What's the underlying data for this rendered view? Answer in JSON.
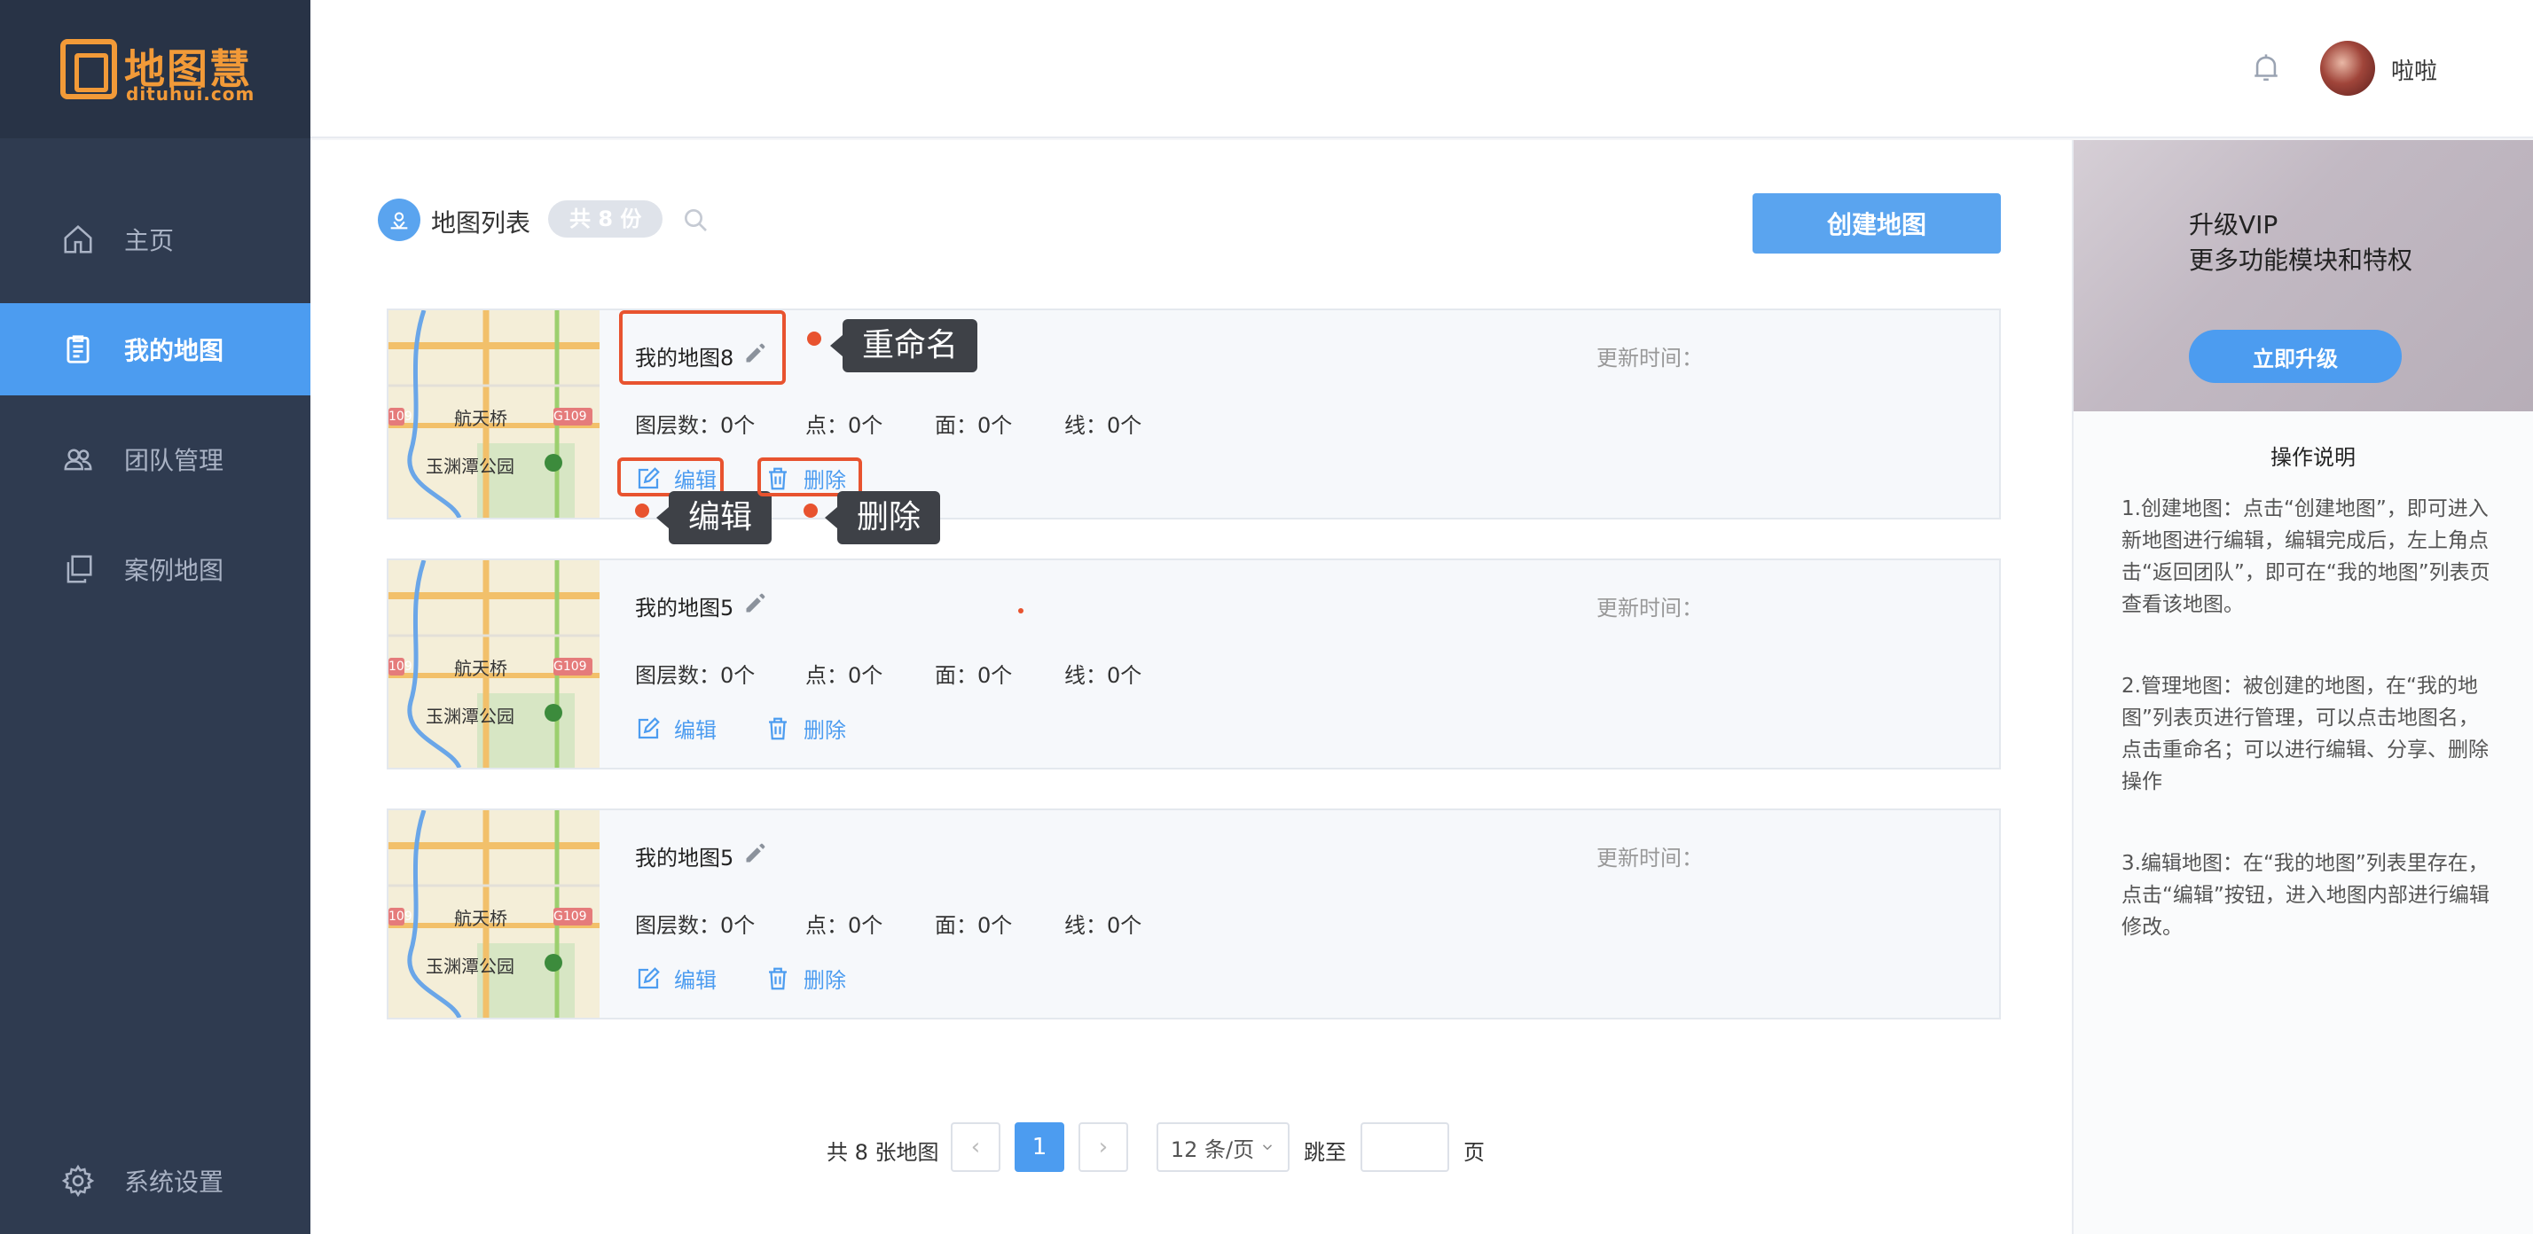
{
  "brand": {
    "name_cn": "地图慧",
    "name_en": "dituhui.com",
    "color": "#f29a38"
  },
  "sidebar": {
    "items": [
      {
        "label": "主页",
        "icon": "home-icon",
        "active": false
      },
      {
        "label": "我的地图",
        "icon": "clipboard-icon",
        "active": true
      },
      {
        "label": "团队管理",
        "icon": "team-icon",
        "active": false
      },
      {
        "label": "案例地图",
        "icon": "copy-icon",
        "active": false
      }
    ],
    "settings_label": "系统设置"
  },
  "header": {
    "username": "啦啦"
  },
  "list": {
    "title": "地图列表",
    "count_badge": "共 8 份",
    "create_button": "创建地图",
    "cards": [
      {
        "name": "我的地图8",
        "updated_label": "更新时间：",
        "stats": {
          "layers": "图层数：0个",
          "points": "点：0个",
          "areas": "面：0个",
          "lines": "线：0个"
        },
        "edit": "编辑",
        "delete": "删除"
      },
      {
        "name": "我的地图5",
        "updated_label": "更新时间：",
        "stats": {
          "layers": "图层数：0个",
          "points": "点：0个",
          "areas": "面：0个",
          "lines": "线：0个"
        },
        "edit": "编辑",
        "delete": "删除"
      },
      {
        "name": "我的地图5",
        "updated_label": "更新时间：",
        "stats": {
          "layers": "图层数：0个",
          "points": "点：0个",
          "areas": "面：0个",
          "lines": "线：0个"
        },
        "edit": "编辑",
        "delete": "删除"
      }
    ],
    "thumb_labels": {
      "bridge": "航天桥",
      "park": "玉渊潭公园",
      "road1": "G109",
      "road2": "109"
    }
  },
  "annotations": {
    "rename": "重命名",
    "edit": "编辑",
    "delete": "删除"
  },
  "pagination": {
    "total": "共 8 张地图",
    "prev": "‹",
    "current": "1",
    "next": "›",
    "page_size": "12 条/页",
    "goto": "跳至",
    "page_unit": "页"
  },
  "right_panel": {
    "vip_title": "升级VIP",
    "vip_subtitle": "更多功能模块和特权",
    "vip_button": "立即升级",
    "help_title": "操作说明",
    "help_items": [
      "1.创建地图：点击“创建地图”，即可进入新地图进行编辑，编辑完成后，左上角点击“返回团队”，即可在“我的地图”列表页查看该地图。",
      "2.管理地图：被创建的地图，在“我的地图”列表页进行管理，可以点击地图名，点击重命名；可以进行编辑、分享、删除操作",
      "3.编辑地图：在“我的地图”列表里存在，点击“编辑”按钮，进入地图内部进行编辑修改。"
    ]
  },
  "colors": {
    "accent": "#4c9cf0",
    "sidebar_bg": "#2f3b50",
    "annotation": "#e8532f"
  }
}
